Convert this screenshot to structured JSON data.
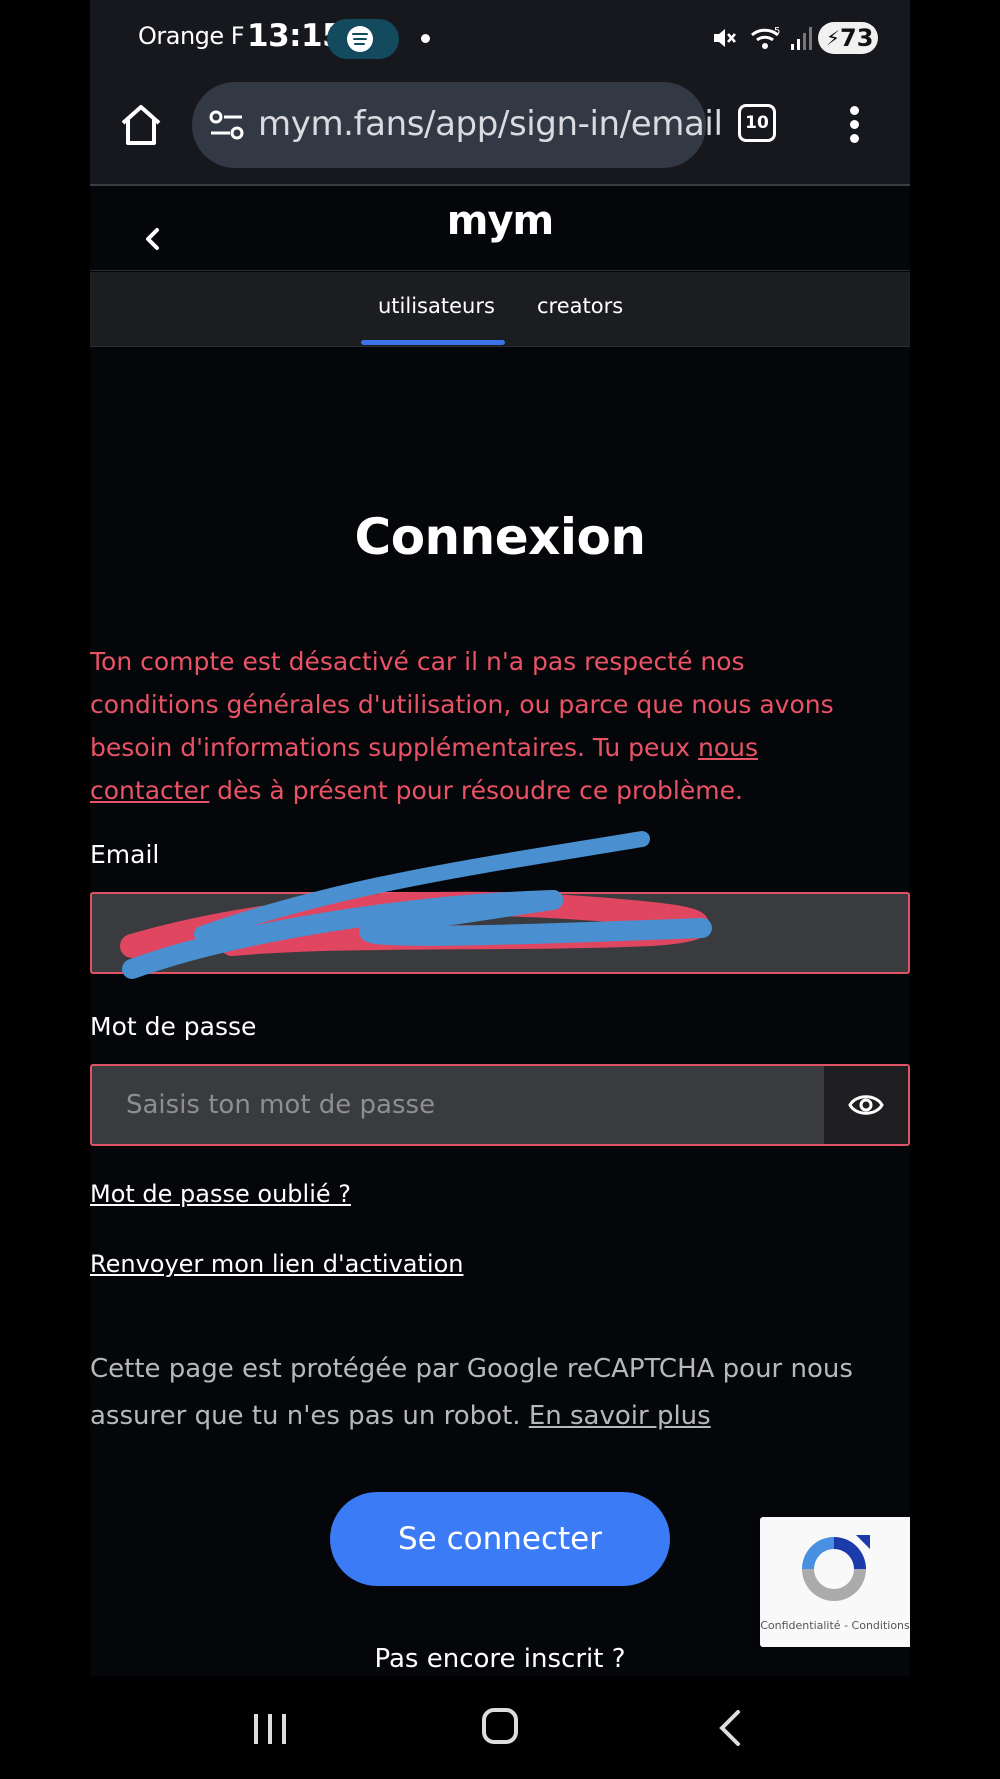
{
  "status_bar": {
    "carrier": "Orange F",
    "time": "13:15",
    "battery": "73",
    "icons": [
      "spotify-icon",
      "dot-icon",
      "mute-icon",
      "wifi-icon",
      "signal-icon",
      "battery-icon"
    ]
  },
  "browser": {
    "url": "mym.fans/app/sign-in/email",
    "tab_count": "10"
  },
  "app": {
    "logo": "mym",
    "tabs": [
      {
        "label": "utilisateurs",
        "active": true
      },
      {
        "label": "creators",
        "active": false
      }
    ],
    "accent_color": "#3b73e8"
  },
  "login": {
    "title": "Connexion",
    "error_part1": "Ton compte est désactivé car il n'a pas respecté nos conditions générales d'utilisation, ou parce que nous avons besoin d'informations supplémentaires. Tu peux ",
    "error_link": "nous contacter",
    "error_part2": " dès à présent pour résoudre ce problème.",
    "error_color": "#ea5365",
    "email_label": "Email",
    "password_label": "Mot de passe",
    "password_placeholder": "Saisis ton mot de passe",
    "forgot_link": "Mot de passe oublié ?",
    "resend_link": "Renvoyer mon lien d'activation",
    "recaptcha_text": "Cette page est protégée par Google reCAPTCHA pour nous assurer que tu n'es pas un robot. ",
    "recaptcha_link": "En savoir plus",
    "submit_label": "Se connecter",
    "submit_color": "#3b7bf5",
    "signup_prompt": "Pas encore inscrit ?"
  },
  "recaptcha_badge": {
    "text": "Confidentialité - Conditions"
  }
}
